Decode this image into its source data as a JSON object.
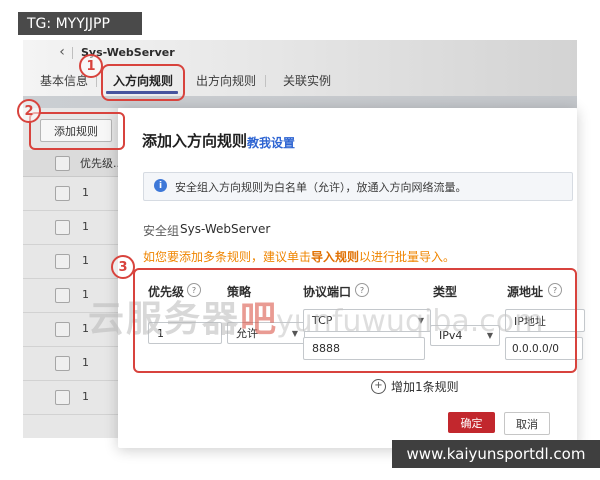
{
  "overlays": {
    "tg_banner": "TG: MYYJJPP",
    "site_banner": "www.kaiyunsportdl.com"
  },
  "watermark": {
    "cn": "云服务器",
    "cn_red": "吧",
    "domain": "yunfuwuqiba.com"
  },
  "breadcrumb": {
    "back_icon": "‹",
    "title": "Sys-WebServer"
  },
  "tabs": [
    {
      "label": "基本信息",
      "active": false
    },
    {
      "label": "入方向规则",
      "active": true
    },
    {
      "label": "出方向规则",
      "active": false
    },
    {
      "label": "关联实例",
      "active": false
    }
  ],
  "annotations": {
    "step1": "1",
    "step2": "2",
    "step3": "3"
  },
  "left_panel": {
    "add_rule_button": "添加规则",
    "table": {
      "header": "优先级...",
      "rows": [
        "1",
        "1",
        "1",
        "1",
        "1",
        "1",
        "1"
      ]
    }
  },
  "dialog": {
    "title": "添加入方向规则",
    "help_link": "教我设置",
    "info_banner": "安全组入方向规则为白名单（允许），放通入方向网络流量。",
    "security_group_label": "安全组",
    "security_group_value": "Sys-WebServer",
    "tip_prefix": "如您要添加多条规则，建议单击",
    "tip_link": "导入规则",
    "tip_suffix": "以进行批量导入。",
    "form": {
      "priority_label": "优先级",
      "priority_value": "1",
      "policy_label": "策略",
      "policy_value": "允许",
      "protocol_label": "协议端口",
      "protocol_value": "TCP",
      "port_value": "8888",
      "type_label": "类型",
      "type_value": "IPv4",
      "source_label": "源地址",
      "source_mode": "IP地址",
      "source_value": "0.0.0.0/0"
    },
    "add_one_rule": "增加1条规则",
    "ok_button": "确定",
    "cancel_button": "取消"
  },
  "icons": {
    "help": "?",
    "info": "i",
    "caret": "▼",
    "plus": "+"
  },
  "colors": {
    "annotation_red": "#d8433d",
    "ok_red": "#c2272d",
    "link_blue": "#2d64d2",
    "tab_underline": "#47549e",
    "tip_orange": "#ef8500"
  }
}
